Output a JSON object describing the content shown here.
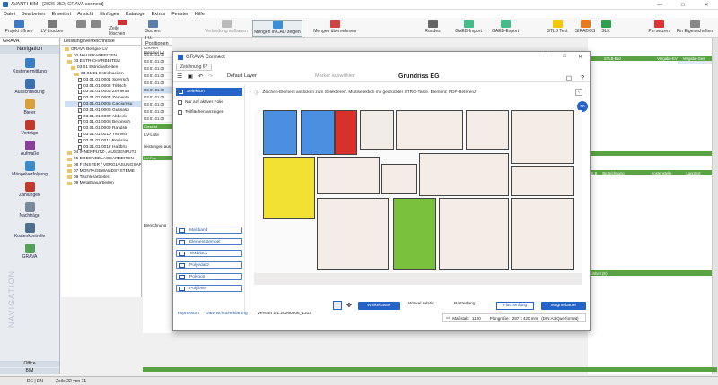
{
  "window": {
    "title": "AVANTI BIM - [2026-052; GRAVA connect]",
    "min": "—",
    "max": "□",
    "close": "✕"
  },
  "menu": [
    "Datei",
    "Bearbeiten",
    "Erweitert",
    "Ansicht",
    "Einfügen",
    "Kataloge",
    "Extras",
    "Fenster",
    "Hilfe"
  ],
  "toolbar": {
    "projekt": "Projekt öffnen",
    "lv": "LV drucken",
    "zeile": "Zeile löschen",
    "suchen": "Suchen",
    "verbindung": "Verbindung aufbauen",
    "mengen_cad": "Mengen in CAD zeigen",
    "mengen_ueb": "Mengen übernehmen",
    "rundes": "Rundes",
    "gaeb_imp": "GAEB-Import",
    "gaeb_exp": "GAEB-Export",
    "stlb": "STLB Text",
    "sirados": "SIRADOS",
    "slk": "SLK",
    "pin": "Pin setzen",
    "pin_eig": "Pin Eigenschaften"
  },
  "nav": {
    "header": "GRAVA",
    "title": "Navigation",
    "items": [
      "Kostenermittlung",
      "Ausschreibung",
      "Bieter",
      "Verträge",
      "Aufmaße",
      "Mängelverfolgung",
      "Zahlungen",
      "Nachträge",
      "Kostenkontrolle",
      "GRAVA"
    ],
    "watermark": "NAVIGATION",
    "office": "Office",
    "bim": "BIM"
  },
  "tree": {
    "header": "Leistungsverzeichnisse",
    "items": [
      "GRAVA Beispiel LV",
      "02  MAUERARBEITEN",
      "03  ESTRICHARBEITEN",
      "03.01  Estricharbeiten",
      "03.01.01  Estrichaeiten",
      "03.01.01.0001  Sperrsch",
      "03.01.01.0002  Trittsch",
      "03.01.01.0003  Zementa",
      "03.01.01.0004  Zementa",
      "03.01.01.0005  Calciumsu",
      "03.01.01.0006  Gussasp",
      "03.01.01.0007  Abdeck",
      "03.01.01.0008  Betonsch",
      "03.01.01.0009  Randstr",
      "03.01.01.0010  Trennstr",
      "03.01.01.0011  Revision",
      "03.01.01.0012  Haftbrü",
      "04  INNENPUTZ-, AUSSENPUTZ",
      "05  BODENBELAGSARBEITEN",
      "06  FENSTER / VERGLASUNGSAR",
      "07  MONTAGEWANDSYSTEME",
      "08  Tischlerarbeiten",
      "09  Metallbauarbeiten"
    ]
  },
  "pos": {
    "header": "LV-Positionen",
    "sub": "GRAVA Beispiel LV",
    "rows": [
      "03.01.01.00",
      "03.01.01.00",
      "03.01.01.00",
      "03.01.01.00",
      "03.01.01.00",
      "03.01.01.00",
      "03.01.01.00",
      "03.01.01.00",
      "03.01.01.00",
      "03.01.01.00"
    ],
    "gesamt": "Gesamt",
    "lvliste": "LV-Liste",
    "lvpos": "LV-Pos",
    "leistungen": "leistungen aus",
    "lvpos2": "LV-Pos",
    "ka": "Ka",
    "berechnung": "Berechnung"
  },
  "right": {
    "cols": [
      "STLB-Bez",
      "Vergabe-EV",
      "Vergabe-Ges"
    ],
    "olb": "OLB",
    "bez": "Bezeichnung",
    "kost": "Kostenstelle",
    "einheitE": "Einheit (E)",
    "langtext": "Langtext"
  },
  "modal": {
    "title": "GRAVA Connect",
    "tab": "Zeichnung 67",
    "layer": "Default Layer",
    "marker": "Marker auswählen",
    "plan": "Grundriss EG",
    "hint": "Zeichen-Element anklicken zum Selektieren. Multiselektion mit gedrückter STRG-Taste. Element; PDF-Referenz",
    "badge": "50",
    "side": {
      "selected": "Selektion",
      "aktiv": "Nur auf aktiver Folie",
      "flaechen": "Teilflächen anzeigen"
    },
    "tools": [
      "Maßband",
      "Elementstempel",
      "Textblock",
      "Polyedaltz",
      "Polygon",
      "Polylinie"
    ],
    "footer": {
      "impressum": "Impressum",
      "datenschutz": "Datenschutzerklärung",
      "version": "Version 2.1.20260506_1312"
    },
    "snap": {
      "winkelraster": "Winkelraster",
      "winkelrel": "Winkel relativ",
      "rasterfang": "Rasterfang",
      "flaechenfang": "Flächenfang",
      "magnetbauer": "Magnetbauer"
    },
    "scale": {
      "label": "Maßstab:",
      "value": "1100",
      "pdf": "Plangröße:",
      "size": "297 x 420 mm",
      "format": "(DIN A3 Querformat)"
    }
  },
  "status": {
    "lang": "DE | EN",
    "zeile": "Zeile 22 von 71"
  },
  "colors": {
    "blue": "#4a8fe0",
    "red": "#d8312c",
    "yellow": "#f2e032",
    "green": "#7ac23e",
    "accent": "#2563c9"
  }
}
